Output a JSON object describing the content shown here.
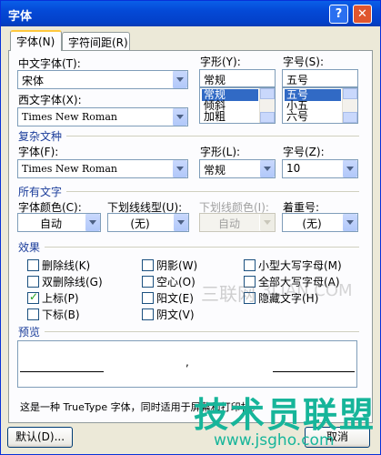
{
  "window": {
    "title": "字体",
    "help": "?",
    "close": "✕"
  },
  "tabs": [
    {
      "label": "字体(N)"
    },
    {
      "label": "字符间距(R)"
    }
  ],
  "chinese_font": {
    "label": "中文字体(T):",
    "value": "宋体"
  },
  "style": {
    "label": "字形(Y):",
    "value": "常规",
    "items": [
      "常规",
      "倾斜",
      "加粗"
    ],
    "selected": "常规"
  },
  "size": {
    "label": "字号(S):",
    "value": "五号",
    "items": [
      "五号",
      "小五",
      "六号"
    ],
    "selected": "五号"
  },
  "western_font": {
    "label": "西文字体(X):",
    "value": "Times New Roman"
  },
  "complex_section": {
    "title": "复杂文种"
  },
  "complex_font": {
    "label": "字体(F):",
    "value": "Times New Roman"
  },
  "complex_style": {
    "label": "字形(L):",
    "value": "常规"
  },
  "complex_size": {
    "label": "字号(Z):",
    "value": "10"
  },
  "all_text_section": {
    "title": "所有文字"
  },
  "font_color": {
    "label": "字体颜色(C):",
    "value": "自动"
  },
  "underline_type": {
    "label": "下划线线型(U):",
    "value": "(无)"
  },
  "underline_color": {
    "label": "下划线颜色(I):",
    "value": "自动"
  },
  "emphasis": {
    "label": "着重号:",
    "value": "(无)"
  },
  "effects_section": {
    "title": "效果"
  },
  "effects": {
    "strikethrough": "删除线(K)",
    "double_strikethrough": "双删除线(G)",
    "superscript": "上标(P)",
    "subscript": "下标(B)",
    "shadow": "阴影(W)",
    "outline": "空心(O)",
    "emboss": "阳文(E)",
    "engrave": "阴文(V)",
    "small_caps": "小型大写字母(M)",
    "all_caps": "全部大写字母(A)",
    "hidden": "隐藏文字(H)"
  },
  "preview_section": {
    "title": "预览"
  },
  "preview": {
    "text": ","
  },
  "info_text": "这是一种 TrueType 字体，同时适用于屏幕和打印机。",
  "buttons": {
    "default": "默认(D)...",
    "cancel": "取消"
  },
  "watermarks": {
    "site_cn": "三联网",
    "site_en": "3LIAN.COM",
    "brand": "技术员联盟",
    "url": "www.jsgho.com"
  }
}
